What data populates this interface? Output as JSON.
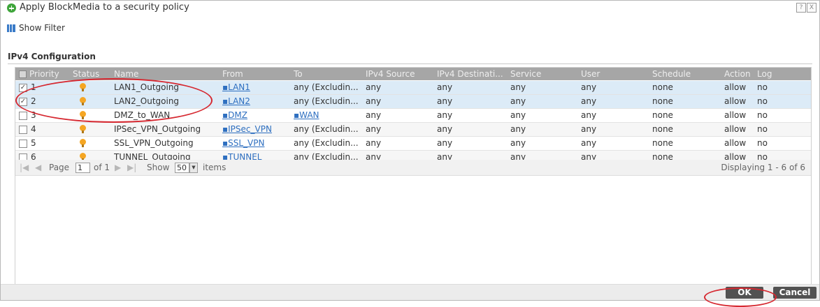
{
  "dialog": {
    "title": "Apply BlockMedia to a security policy",
    "help_icon": "?",
    "close_icon": "X"
  },
  "toolbar": {
    "show_filter": "Show Filter"
  },
  "section": {
    "title": "IPv4 Configuration"
  },
  "table": {
    "columns": {
      "priority": "Priority",
      "status": "Status",
      "name": "Name",
      "from": "From",
      "to": "To",
      "source": "IPv4 Source",
      "destination": "IPv4 Destinati...",
      "service": "Service",
      "user": "User",
      "schedule": "Schedule",
      "action": "Action",
      "log": "Log"
    },
    "rows": [
      {
        "checked": true,
        "check_mark": "✓",
        "priority": "1",
        "status_icon": "bulb-icon",
        "name": "LAN1_Outgoing",
        "from": "LAN1",
        "to": "any (Excludin...",
        "source": "any",
        "destination": "any",
        "service": "any",
        "user": "any",
        "schedule": "none",
        "action": "allow",
        "log": "no"
      },
      {
        "checked": true,
        "check_mark": "✓",
        "priority": "2",
        "status_icon": "bulb-icon",
        "name": "LAN2_Outgoing",
        "from": "LAN2",
        "to": "any (Excludin...",
        "source": "any",
        "destination": "any",
        "service": "any",
        "user": "any",
        "schedule": "none",
        "action": "allow",
        "log": "no"
      },
      {
        "checked": false,
        "check_mark": "",
        "priority": "3",
        "status_icon": "bulb-icon",
        "name": "DMZ_to_WAN",
        "from": "DMZ",
        "to": "WAN",
        "source": "any",
        "destination": "any",
        "service": "any",
        "user": "any",
        "schedule": "none",
        "action": "allow",
        "log": "no"
      },
      {
        "checked": false,
        "check_mark": "",
        "priority": "4",
        "status_icon": "bulb-icon",
        "name": "IPSec_VPN_Outgoing",
        "from": "IPSec_VPN",
        "to": "any (Excludin...",
        "source": "any",
        "destination": "any",
        "service": "any",
        "user": "any",
        "schedule": "none",
        "action": "allow",
        "log": "no"
      },
      {
        "checked": false,
        "check_mark": "",
        "priority": "5",
        "status_icon": "bulb-icon",
        "name": "SSL_VPN_Outgoing",
        "from": "SSL_VPN",
        "to": "any (Excludin...",
        "source": "any",
        "destination": "any",
        "service": "any",
        "user": "any",
        "schedule": "none",
        "action": "allow",
        "log": "no"
      },
      {
        "checked": false,
        "check_mark": "",
        "priority": "6",
        "status_icon": "bulb-icon",
        "name": "TUNNEL_Outgoing",
        "from": "TUNNEL",
        "to": "any (Excludin...",
        "source": "any",
        "destination": "any",
        "service": "any",
        "user": "any",
        "schedule": "none",
        "action": "allow",
        "log": "no"
      }
    ]
  },
  "pager": {
    "first": "|◀",
    "prev": "◀",
    "page_label": "Page",
    "page_value": "1",
    "of_label": "of 1",
    "next": "▶",
    "last": "▶|",
    "show_label": "Show",
    "show_value": "50",
    "items_label": "items",
    "displaying": "Displaying 1 - 6 of 6"
  },
  "buttons": {
    "ok": "OK",
    "cancel": "Cancel"
  },
  "colors": {
    "header": "#a6a6a6",
    "selected_row": "#dcebf7",
    "annotation": "#d62830",
    "status_on": "#f5a623",
    "link": "#2e6fc0"
  }
}
